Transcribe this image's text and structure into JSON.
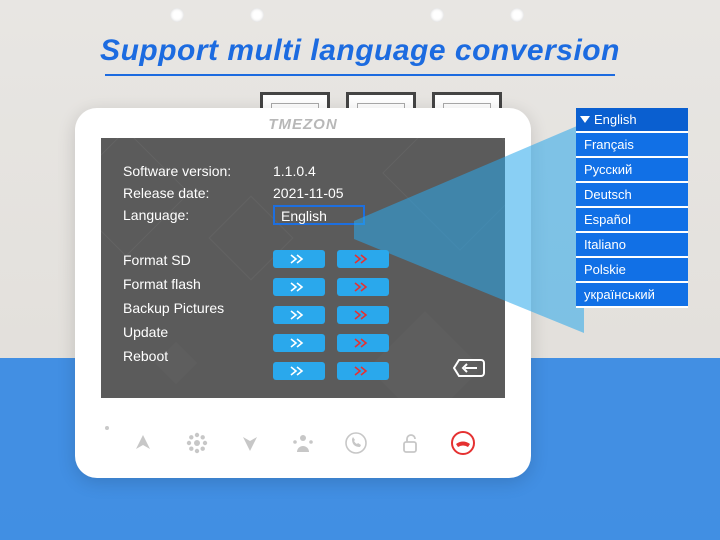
{
  "headline": "Support multi language conversion",
  "brand": "TMEZON",
  "device": {
    "info": {
      "software_version_label": "Software version:",
      "software_version_value": "1.1.0.4",
      "release_date_label": "Release date:",
      "release_date_value": "2021-11-05",
      "language_label": "Language:",
      "language_value": "English"
    },
    "commands": {
      "format_sd": "Format SD",
      "format_flash": "Format flash",
      "backup_pictures": "Backup Pictures",
      "update": "Update",
      "reboot": "Reboot"
    }
  },
  "languages": [
    "English",
    "Français",
    "Русский",
    "Deutsch",
    "Español",
    "Italiano",
    "Polskie",
    "український"
  ],
  "colors": {
    "accent": "#1c6be0",
    "list_bg": "#1170e6",
    "button_blue": "#2aa8ec",
    "danger": "#e53131"
  }
}
